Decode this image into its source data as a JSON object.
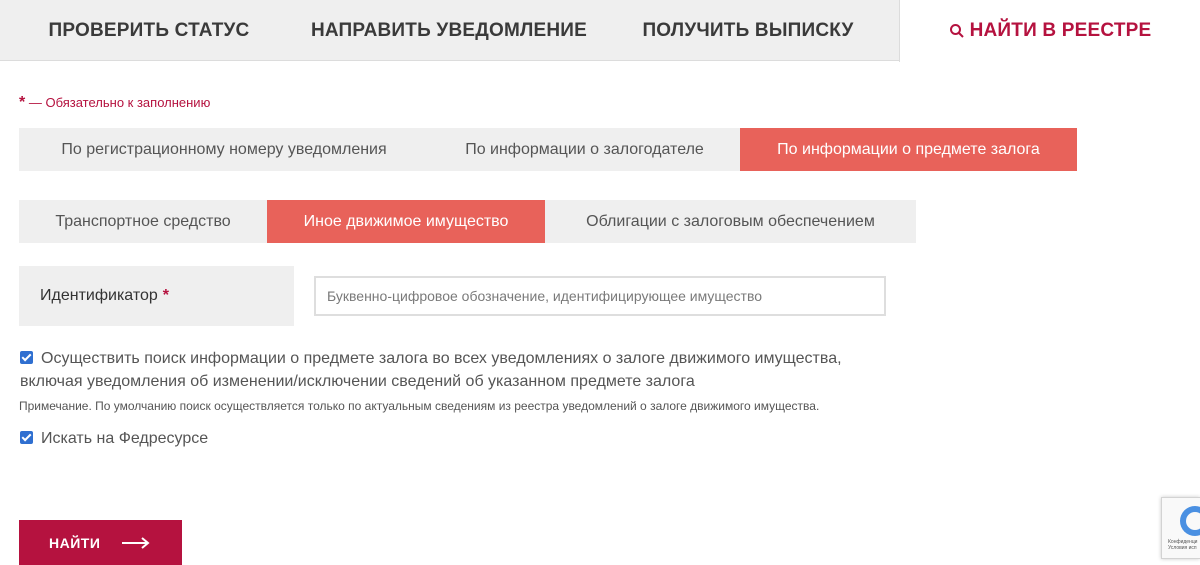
{
  "top_nav": {
    "tabs": [
      {
        "label": "ПРОВЕРИТЬ СТАТУС"
      },
      {
        "label": "НАПРАВИТЬ УВЕДОМЛЕНИЕ"
      },
      {
        "label": "ПОЛУЧИТЬ ВЫПИСКУ"
      },
      {
        "label": "НАЙТИ В РЕЕСТРЕ",
        "icon": "search-icon",
        "active": true
      }
    ]
  },
  "required_note": {
    "star": "*",
    "text": " — Обязательно к заполнению"
  },
  "search_by": {
    "options": [
      {
        "label": "По регистрационному номеру уведомления"
      },
      {
        "label": "По информации о залогодателе"
      },
      {
        "label": "По информации о предмете залога",
        "active": true
      }
    ]
  },
  "property_type": {
    "options": [
      {
        "label": "Транспортное средство"
      },
      {
        "label": "Иное движимое имущество",
        "active": true
      },
      {
        "label": "Облигации с залоговым обеспечением"
      }
    ]
  },
  "identifier": {
    "label": "Идентификатор",
    "required_mark": "*",
    "placeholder": "Буквенно-цифровое обозначение, идентифицирующее имущество",
    "value": ""
  },
  "options": {
    "search_all": {
      "checked": true,
      "line1": "Осуществить поиск информации о предмете залога во всех уведомлениях о залоге движимого имущества,",
      "line2": "включая уведомления об изменении/исключении сведений об указанном предмете залога"
    },
    "note": "Примечание. По умолчанию поиск осуществляется только по актуальным сведениям из реестра уведомлений о залоге движимого имущества.",
    "fedresurs": {
      "checked": true,
      "label": "Искать на Федресурсе"
    }
  },
  "submit": {
    "label": "НАЙТИ",
    "icon": "arrow-right-icon"
  },
  "recaptcha": {
    "text1": "Конфиденци",
    "text2": "Условия исп"
  },
  "colors": {
    "accent": "#b5123f",
    "active_segment": "#e8625a",
    "segment_bg": "#efefef",
    "checkbox": "#2f6fd0"
  }
}
